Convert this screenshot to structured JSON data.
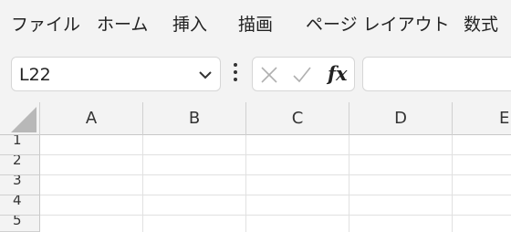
{
  "menu": {
    "items": [
      {
        "label": "ファイル"
      },
      {
        "label": "ホーム"
      },
      {
        "label": "挿入"
      },
      {
        "label": "描画"
      },
      {
        "label": "ページ レイアウト"
      },
      {
        "label": "数式"
      }
    ]
  },
  "formula_bar": {
    "name_box_value": "L22",
    "fx_label": "fx",
    "formula_value": ""
  },
  "grid": {
    "columns": [
      "A",
      "B",
      "C",
      "D",
      "E"
    ],
    "rows": [
      "1",
      "2",
      "3",
      "4",
      "5"
    ]
  },
  "icons": {
    "dropdown": "chevron-down-icon",
    "more": "more-vertical-icon",
    "cancel": "cancel-x-icon",
    "enter": "check-icon"
  }
}
